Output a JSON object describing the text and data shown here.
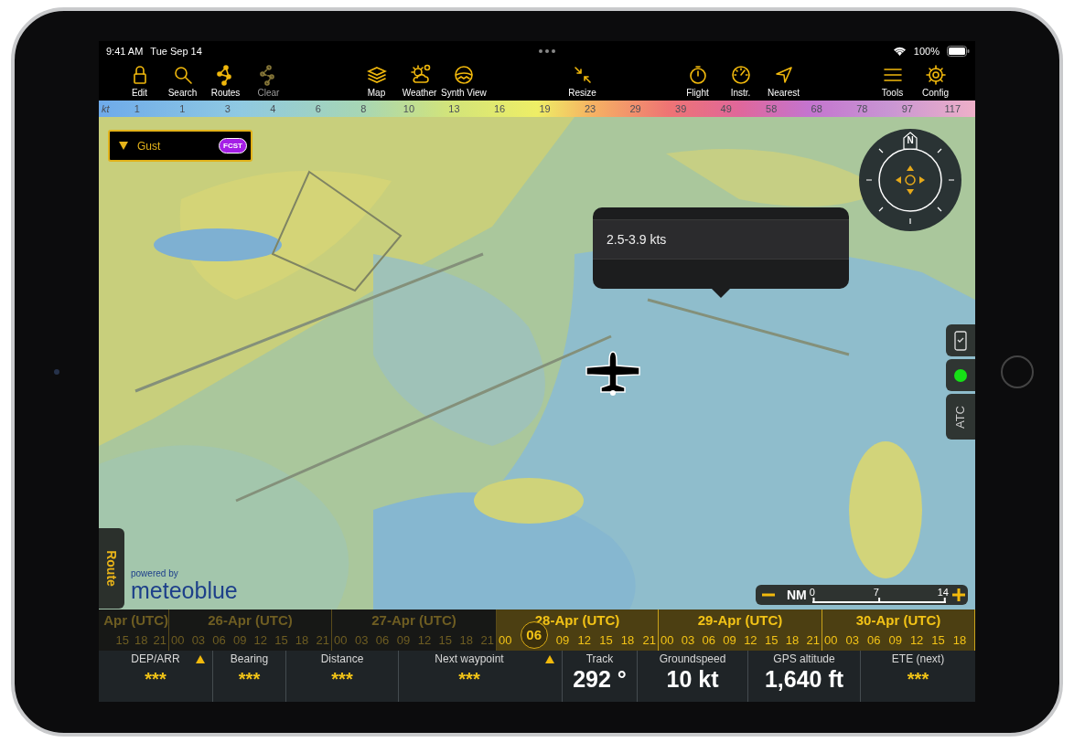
{
  "status_bar": {
    "time": "9:41 AM",
    "date": "Tue Sep 14",
    "battery": "100%"
  },
  "toolbar": [
    {
      "items": [
        {
          "label": "Edit",
          "disabled": false
        },
        {
          "label": "Search",
          "disabled": false
        },
        {
          "label": "Routes",
          "disabled": false
        },
        {
          "label": "Clear",
          "disabled": true
        }
      ]
    },
    {
      "items": [
        {
          "label": "Map",
          "disabled": false
        },
        {
          "label": "Weather",
          "disabled": false
        },
        {
          "label": "Synth View",
          "disabled": false
        }
      ]
    },
    {
      "items": [
        {
          "label": "Resize",
          "disabled": false
        }
      ]
    },
    {
      "items": [
        {
          "label": "Flight",
          "disabled": false
        },
        {
          "label": "Instr.",
          "disabled": false
        },
        {
          "label": "Nearest",
          "disabled": false
        }
      ]
    },
    {
      "items": [
        {
          "label": "Tools",
          "disabled": false
        },
        {
          "label": "Config",
          "disabled": false
        }
      ]
    }
  ],
  "color_scale": {
    "unit": "kt",
    "values": [
      "1",
      "1",
      "3",
      "4",
      "6",
      "8",
      "10",
      "13",
      "16",
      "19",
      "23",
      "29",
      "39",
      "49",
      "58",
      "68",
      "78",
      "97",
      "117"
    ]
  },
  "map": {
    "kind": "picture",
    "layer_panel": {
      "label": "Gust",
      "badge": "FCST"
    },
    "compass": {
      "north": "N"
    },
    "popup": {
      "text": "2.5-3.9 kts"
    },
    "side_buttons": {
      "atc": "ATC"
    },
    "route_tab": "Route",
    "attribution": {
      "prefix": "powered by",
      "brand": "meteoblue"
    },
    "scale": {
      "unit": "NM",
      "ticks": [
        "0",
        "7",
        "14"
      ]
    }
  },
  "timeline": {
    "cursor": "06",
    "days": [
      {
        "label": "Apr (UTC)",
        "hours": [
          "15",
          "18",
          "21"
        ],
        "highlighted": false
      },
      {
        "label": "26-Apr (UTC)",
        "hours": [
          "00",
          "03",
          "06",
          "09",
          "12",
          "15",
          "18",
          "21"
        ],
        "highlighted": false
      },
      {
        "label": "27-Apr (UTC)",
        "hours": [
          "00",
          "03",
          "06",
          "09",
          "12",
          "15",
          "18",
          "21"
        ],
        "highlighted": false
      },
      {
        "label": "28-Apr (UTC)",
        "hours": [
          "00",
          "09",
          "12",
          "15",
          "18",
          "21"
        ],
        "highlighted": true,
        "current": true
      },
      {
        "label": "29-Apr (UTC)",
        "hours": [
          "00",
          "03",
          "06",
          "09",
          "12",
          "15",
          "18",
          "21"
        ],
        "highlighted": true
      },
      {
        "label": "30-Apr (UTC)",
        "hours": [
          "00",
          "03",
          "06",
          "09",
          "12",
          "15",
          "18"
        ],
        "highlighted": true
      }
    ]
  },
  "info_bar": [
    {
      "label": "DEP/ARR",
      "value": "***",
      "kind": "empty"
    },
    {
      "label": "Bearing",
      "value": "***",
      "kind": "empty"
    },
    {
      "label": "Distance",
      "value": "***",
      "kind": "empty"
    },
    {
      "label": "Next waypoint",
      "value": "***",
      "kind": "empty"
    },
    {
      "label": "Track",
      "value": "292 °",
      "kind": "reading"
    },
    {
      "label": "Groundspeed",
      "value": "10 kt",
      "kind": "reading"
    },
    {
      "label": "GPS altitude",
      "value": "1,640 ft",
      "kind": "reading"
    },
    {
      "label": "ETE (next)",
      "value": "***",
      "kind": "empty"
    }
  ]
}
